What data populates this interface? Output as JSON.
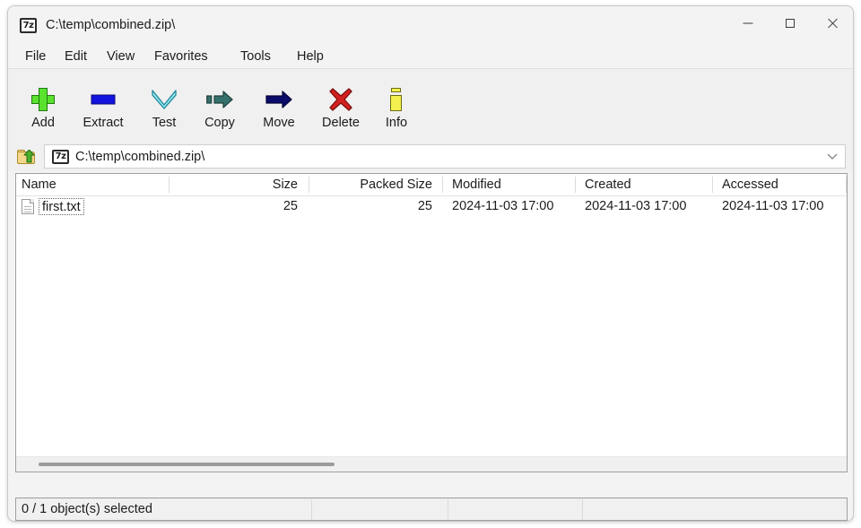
{
  "window": {
    "title": "C:\\temp\\combined.zip\\",
    "app_icon": "7z",
    "controls": {
      "minimize": "minimize-icon",
      "maximize": "maximize-icon",
      "close": "close-icon"
    }
  },
  "menu": {
    "items": [
      {
        "label": "File"
      },
      {
        "label": "Edit"
      },
      {
        "label": "View"
      },
      {
        "label": "Favorites"
      },
      {
        "label": "Tools"
      },
      {
        "label": "Help"
      }
    ]
  },
  "toolbar": {
    "buttons": [
      {
        "label": "Add",
        "icon": "plus-icon"
      },
      {
        "label": "Extract",
        "icon": "extract-bar-icon"
      },
      {
        "label": "Test",
        "icon": "chevron-down-icon"
      },
      {
        "label": "Copy",
        "icon": "copy-arrow-icon"
      },
      {
        "label": "Move",
        "icon": "move-arrow-icon"
      },
      {
        "label": "Delete",
        "icon": "delete-x-icon"
      },
      {
        "label": "Info",
        "icon": "info-icon"
      }
    ]
  },
  "address_bar": {
    "up_icon": "folder-up-icon",
    "archive_icon": "7z",
    "path": "C:\\temp\\combined.zip\\",
    "dropdown_icon": "chevron-down-icon"
  },
  "file_list": {
    "columns": [
      {
        "label": "Name",
        "align": "left"
      },
      {
        "label": "Size",
        "align": "right"
      },
      {
        "label": "Packed Size",
        "align": "right"
      },
      {
        "label": "Modified",
        "align": "left"
      },
      {
        "label": "Created",
        "align": "left"
      },
      {
        "label": "Accessed",
        "align": "left"
      }
    ],
    "rows": [
      {
        "icon": "text-file-icon",
        "name": "first.txt",
        "size": "25",
        "packed_size": "25",
        "modified": "2024-11-03 17:00",
        "created": "2024-11-03 17:00",
        "accessed": "2024-11-03 17:00"
      }
    ]
  },
  "status_bar": {
    "selection": "0 / 1 object(s) selected",
    "cell2": "",
    "cell3": "",
    "cell4": ""
  },
  "colors": {
    "window_bg": "#f3f3f3",
    "toolbar_bg": "#f0f0f0",
    "list_bg": "#ffffff",
    "text": "#1b1b1b",
    "border": "#a0a0a0",
    "add_green": "#5ae22e",
    "extract_blue": "#1313e0",
    "test_cyan": "#9ef0f5",
    "copy_teal": "#35706c",
    "move_navy": "#0b0b6b",
    "delete_red": "#d32020",
    "info_yellow": "#f2ef4e"
  }
}
